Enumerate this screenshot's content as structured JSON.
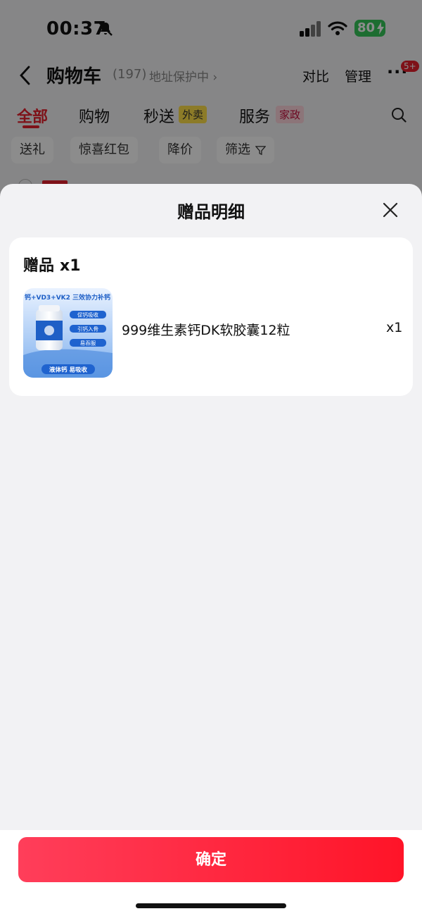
{
  "status_bar": {
    "time": "00:37",
    "battery": "80"
  },
  "header": {
    "title": "购物车",
    "count": "(197)",
    "address_protect": "地址保护中 ›",
    "compare": "对比",
    "manage": "管理",
    "more": "···",
    "badge": "5+"
  },
  "tabs": [
    {
      "label": "全部"
    },
    {
      "label": "购物"
    },
    {
      "label": "秒送",
      "tag": "外卖"
    },
    {
      "label": "服务",
      "tag": "家政"
    }
  ],
  "chips": [
    "送礼",
    "惊喜红包",
    "降价",
    "筛选"
  ],
  "sheet": {
    "title": "赠品明细",
    "section_title": "赠品",
    "section_count": "x1",
    "item": {
      "name": "999维生素钙DK软胶囊12粒",
      "qty": "x1"
    },
    "thumb": {
      "headline": "钙+VD3+VK2 三效协力补钙",
      "features": [
        "促钙吸收",
        "引钙入骨",
        "易吞服"
      ],
      "bottom": "液体钙 易吸收"
    },
    "confirm": "确定"
  },
  "colors": {
    "accent": "#e61f2c",
    "button_start": "#ff3e5a",
    "button_end": "#ff1428"
  }
}
